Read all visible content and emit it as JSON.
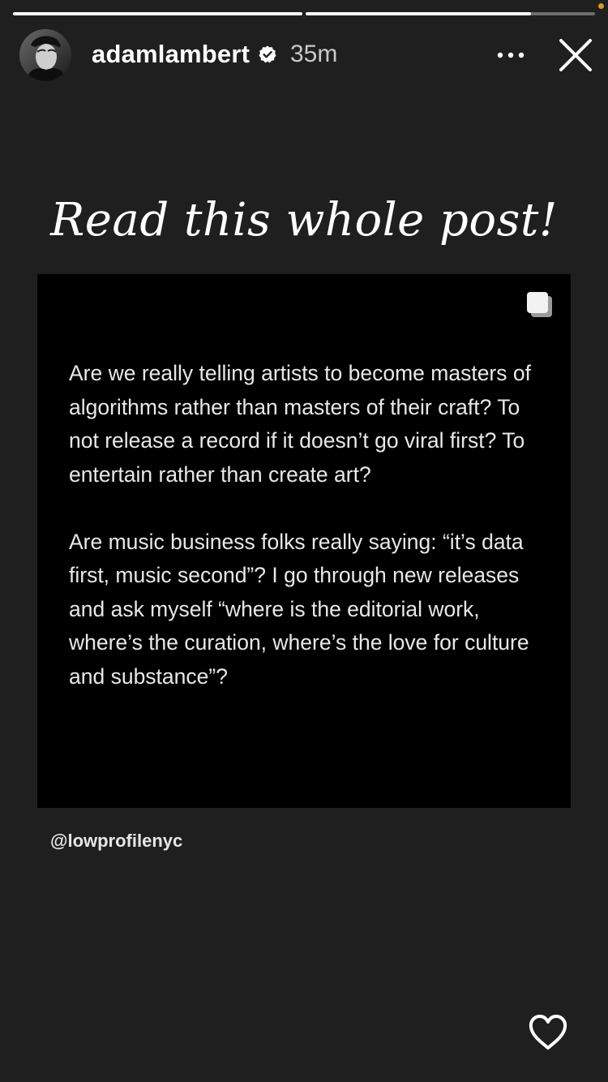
{
  "story": {
    "progress": [
      {
        "fraction": 1.0
      },
      {
        "fraction": 0.78
      }
    ]
  },
  "header": {
    "username": "adamlambert",
    "verified": true,
    "timestamp": "35m",
    "more_icon": "more-horizontal-icon",
    "close_icon": "close-icon"
  },
  "content": {
    "headline": "Read this whole post!",
    "post": {
      "carousel_icon": "carousel-stack-icon",
      "paragraphs": [
        "Are we really telling artists to become masters of algorithms rather than masters of their craft? To not release a record if it doesn’t go viral first? To entertain rather than create art?",
        "Are music business folks really saying: “it’s data first, music second”? I go through new releases and ask myself “where is the editorial work, where’s the curation, where’s the love for culture and substance”?"
      ]
    },
    "mention": "@lowprofilenyc"
  },
  "footer": {
    "like_icon": "heart-icon"
  },
  "colors": {
    "background": "#1f1f1f",
    "post_background": "#000000",
    "accent_dot": "#e3931c"
  }
}
